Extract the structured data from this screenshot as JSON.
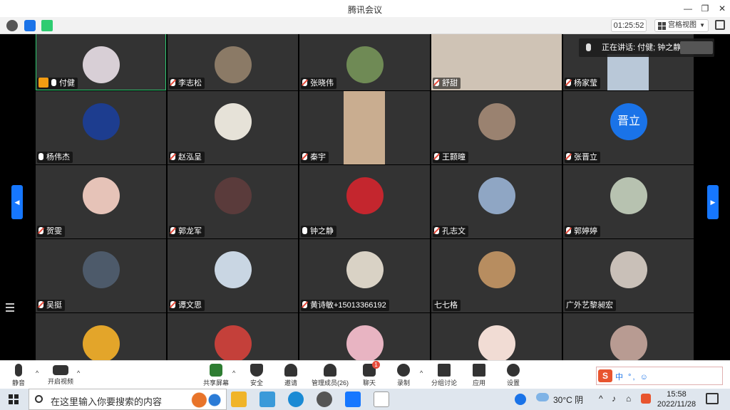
{
  "window": {
    "title": "腾讯会议"
  },
  "toolbar": {
    "timer": "01:25:52",
    "view_label": "宫格视图"
  },
  "speaking": "正在讲话: 付健; 钟之静;",
  "tiles": [
    {
      "name": "付健",
      "host": true,
      "muted": false,
      "kind": "avatar",
      "color": "#d8cfd6"
    },
    {
      "name": "李志松",
      "muted": true,
      "kind": "avatar",
      "color": "#8b7a66"
    },
    {
      "name": "张晓伟",
      "muted": true,
      "kind": "avatar",
      "color": "#6f8a55"
    },
    {
      "name": "舒甜",
      "muted": true,
      "kind": "video",
      "color": "#cfc3b5"
    },
    {
      "name": "杨家莹",
      "muted": true,
      "kind": "video-small",
      "color": "#b9c8d8"
    },
    {
      "name": "杨伟杰",
      "muted": false,
      "kind": "avatar",
      "color": "#1d3d8f"
    },
    {
      "name": "赵泓呈",
      "muted": true,
      "kind": "avatar",
      "color": "#e6e2d8"
    },
    {
      "name": "秦宇",
      "muted": true,
      "kind": "video-small",
      "color": "#c9ad90"
    },
    {
      "name": "王颢曈",
      "muted": true,
      "kind": "avatar",
      "color": "#9a8270"
    },
    {
      "name": "张晋立",
      "muted": true,
      "kind": "initials",
      "initials": "晋立",
      "color": "#1a73e8"
    },
    {
      "name": "贺雯",
      "muted": true,
      "kind": "avatar",
      "color": "#e6c3b8"
    },
    {
      "name": "郭龙军",
      "muted": true,
      "kind": "avatar",
      "color": "#5a3b3b"
    },
    {
      "name": "钟之静",
      "muted": false,
      "kind": "avatar",
      "color": "#c4262e"
    },
    {
      "name": "孔志文",
      "muted": true,
      "kind": "avatar",
      "color": "#8fa6c4"
    },
    {
      "name": "郭婷婷",
      "muted": true,
      "kind": "avatar",
      "color": "#b7c2b0"
    },
    {
      "name": "吴挺",
      "muted": true,
      "kind": "avatar",
      "color": "#4d5a6a"
    },
    {
      "name": "谭文思",
      "muted": true,
      "kind": "avatar",
      "color": "#c9d6e3"
    },
    {
      "name": "黄诗敏+15013366192",
      "muted": true,
      "kind": "avatar",
      "color": "#d9d2c5"
    },
    {
      "name": "七七格",
      "muted": null,
      "kind": "avatar",
      "color": "#b78d60"
    },
    {
      "name": "广外艺黎昶宏",
      "muted": null,
      "kind": "avatar",
      "color": "#c9c0b8"
    },
    {
      "name": "",
      "muted": null,
      "kind": "avatar",
      "color": "#e3a52a"
    },
    {
      "name": "",
      "muted": null,
      "kind": "avatar",
      "color": "#c4403a"
    },
    {
      "name": "",
      "muted": null,
      "kind": "avatar",
      "color": "#e8b4c2"
    },
    {
      "name": "",
      "muted": null,
      "kind": "avatar",
      "color": "#f1dcd4"
    },
    {
      "name": "",
      "muted": null,
      "kind": "avatar",
      "color": "#b89b92"
    }
  ],
  "controls": {
    "mute": "静音",
    "video": "开启视频",
    "share": "共享屏幕",
    "security": "安全",
    "invite": "邀请",
    "members": "管理成员(26)",
    "chat": "聊天",
    "chat_badge": "1",
    "record": "录制",
    "breakout": "分组讨论",
    "apps": "应用",
    "settings": "设置"
  },
  "ime": {
    "logo": "S",
    "text": "中 °, ☺"
  },
  "taskbar": {
    "search_placeholder": "在这里输入你要搜索的内容",
    "weather": "30°C 阴",
    "time": "15:58",
    "date": "2022/11/28",
    "notif_count": "1"
  }
}
